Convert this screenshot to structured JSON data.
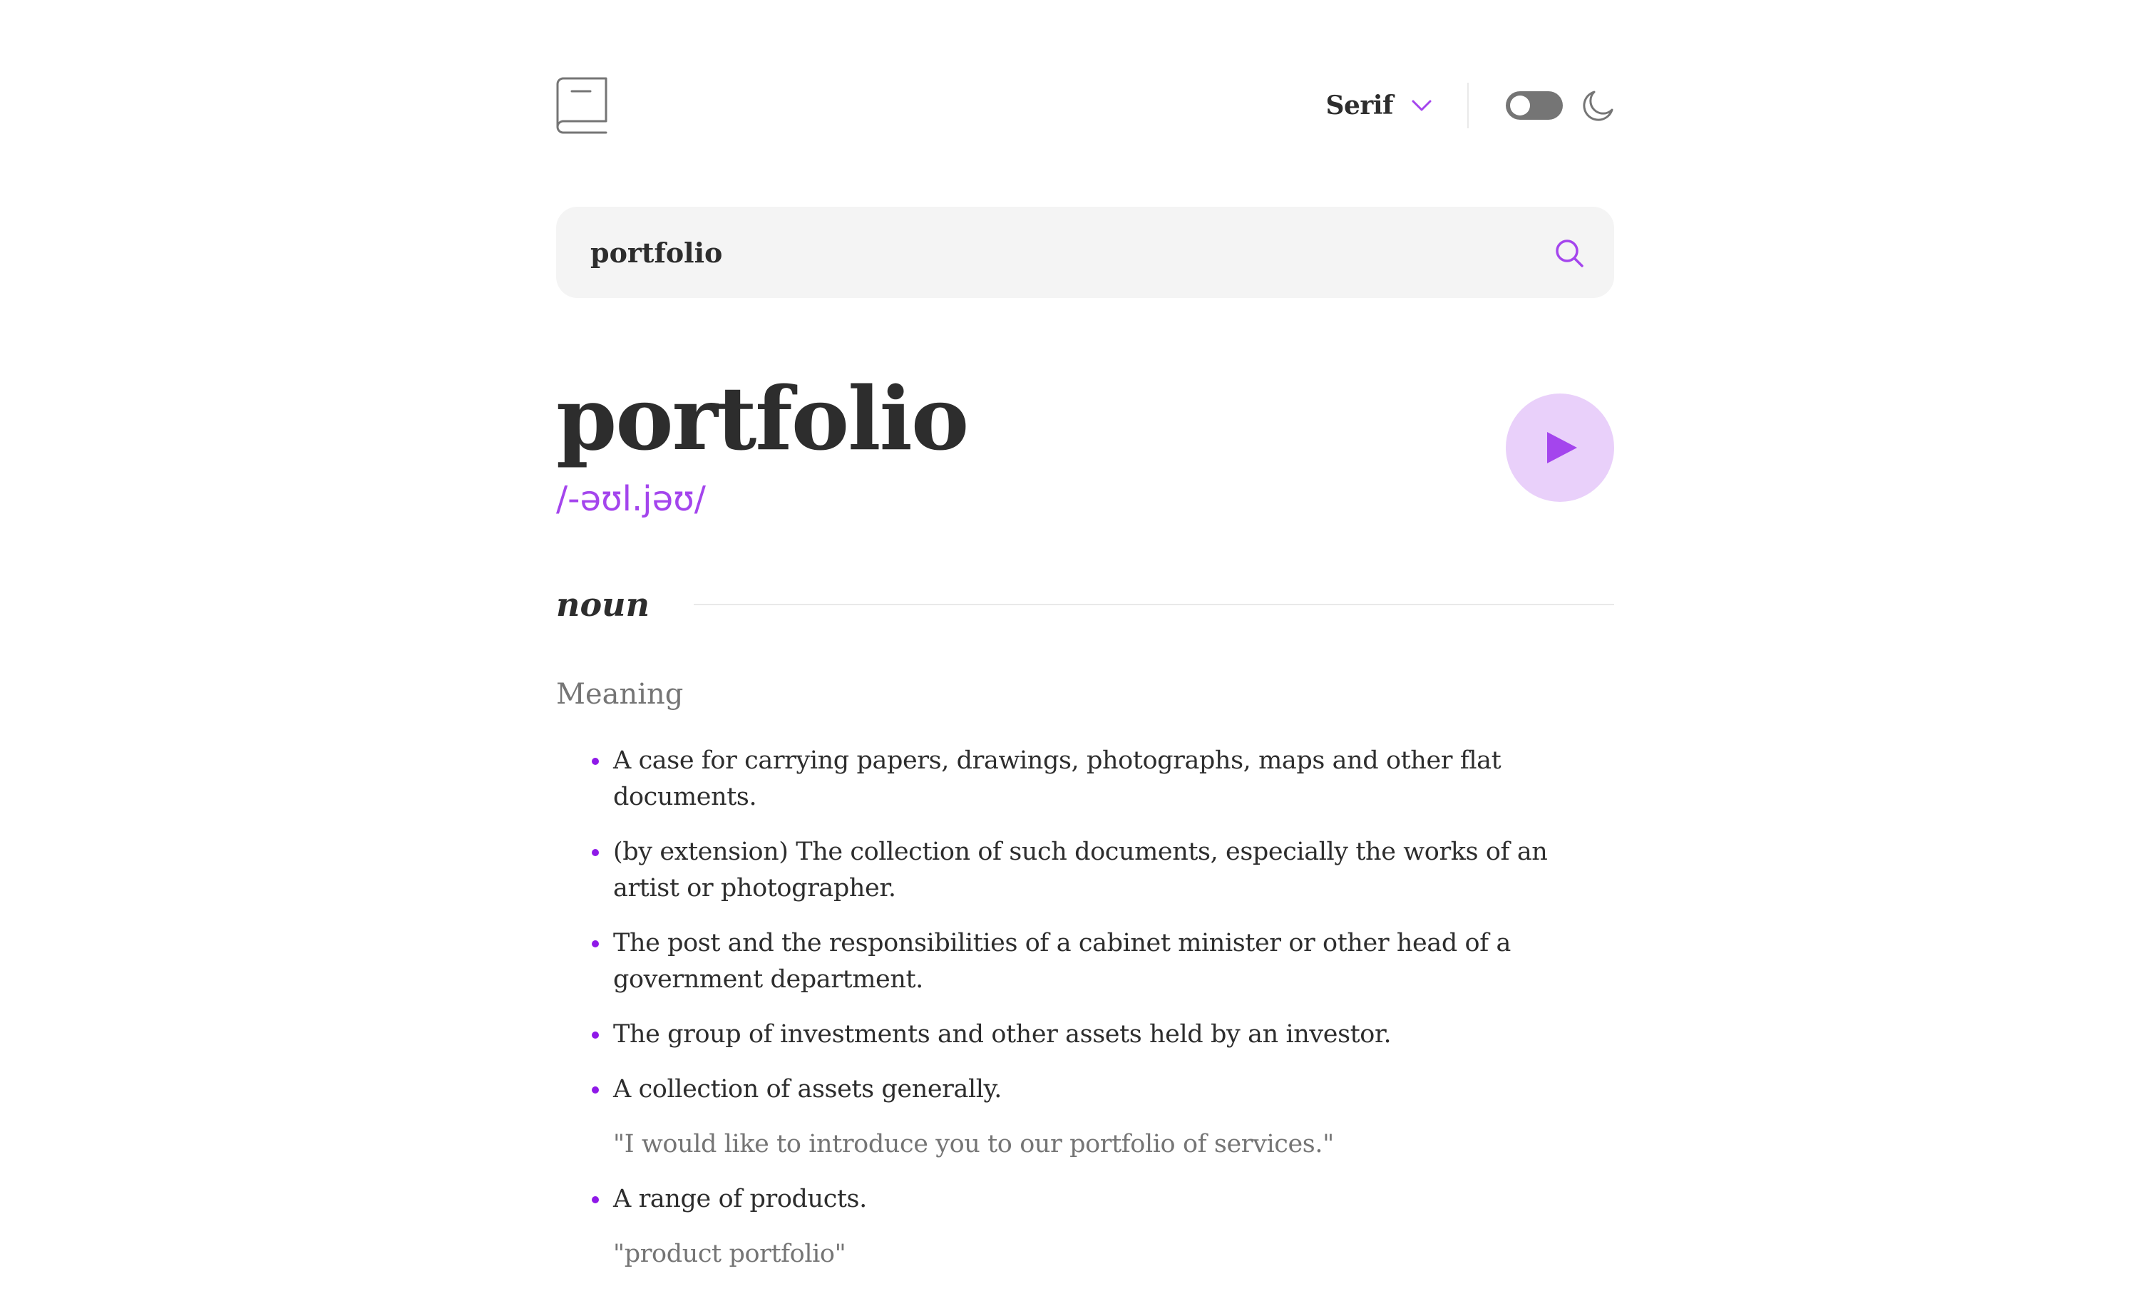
{
  "header": {
    "logo_icon": "book-icon",
    "font_selector": {
      "selected": "Serif",
      "icon": "chevron-down-icon"
    },
    "theme_toggle": {
      "state": "off",
      "icon": "moon-icon"
    }
  },
  "search": {
    "value": "portfolio",
    "icon": "search-icon"
  },
  "entry": {
    "word": "portfolio",
    "phonetic": "/-əʊl.jəʊ/",
    "play_icon": "play-icon",
    "part_of_speech": "noun",
    "meaning_heading": "Meaning",
    "definitions": [
      {
        "text": "A case for carrying papers, drawings, photographs, maps and other flat documents.",
        "example": ""
      },
      {
        "text": "(by extension) The collection of such documents, especially the works of an artist or photographer.",
        "example": ""
      },
      {
        "text": "The post and the responsibilities of a cabinet minister or other head of a government department.",
        "example": ""
      },
      {
        "text": "The group of investments and other assets held by an investor.",
        "example": ""
      },
      {
        "text": "A collection of assets generally.",
        "example": "\"I would like to introduce you to our portfolio of services.\""
      },
      {
        "text": "A range of products.",
        "example": "\"product portfolio\""
      }
    ]
  },
  "colors": {
    "accent": "#a445ed",
    "accent_light": "#e9d0fa",
    "text": "#2d2d2d",
    "muted": "#757575",
    "search_bg": "#f4f4f4",
    "divider": "#e9e9e9"
  }
}
